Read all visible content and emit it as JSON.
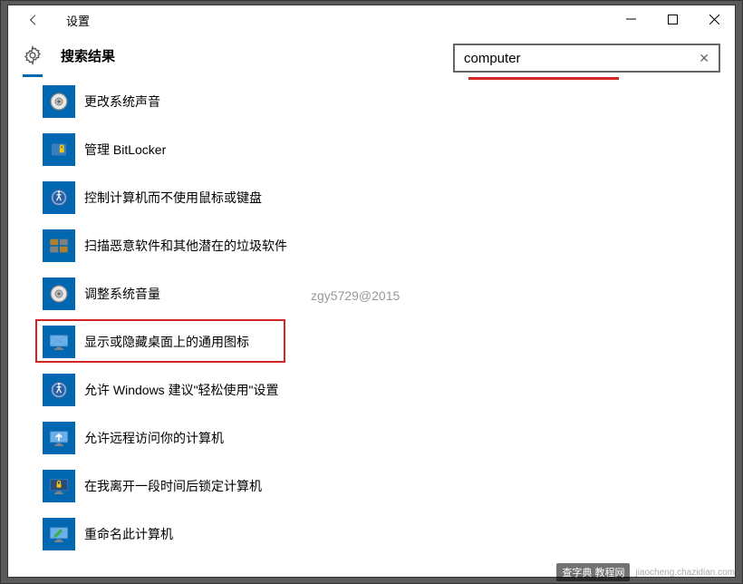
{
  "window": {
    "title": "设置",
    "page_heading": "搜索结果"
  },
  "search": {
    "value": "computer",
    "placeholder": ""
  },
  "watermark": "zgy5729@2015",
  "footer": {
    "badge": "查字典 教程网",
    "url": "jiaocheng.chazidian.com"
  },
  "results": [
    {
      "label": "更改系统声音",
      "icon": "speaker"
    },
    {
      "label": "管理 BitLocker",
      "icon": "bitlocker"
    },
    {
      "label": "控制计算机而不使用鼠标或键盘",
      "icon": "accessibility"
    },
    {
      "label": "扫描恶意软件和其他潜在的垃圾软件",
      "icon": "defender"
    },
    {
      "label": "调整系统音量",
      "icon": "speaker"
    },
    {
      "label": "显示或隐藏桌面上的通用图标",
      "icon": "monitor"
    },
    {
      "label": "允许 Windows 建议\"轻松使用\"设置",
      "icon": "accessibility"
    },
    {
      "label": "允许远程访问你的计算机",
      "icon": "remote"
    },
    {
      "label": "在我离开一段时间后锁定计算机",
      "icon": "lock-monitor"
    },
    {
      "label": "重命名此计算机",
      "icon": "rename-monitor"
    }
  ]
}
